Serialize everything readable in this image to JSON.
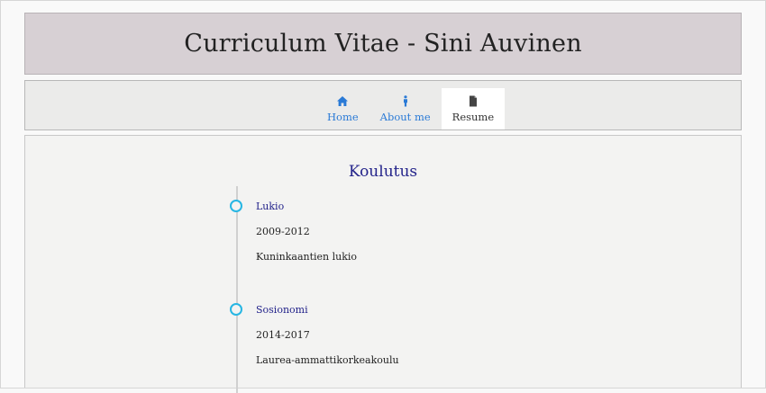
{
  "header": {
    "title": "Curriculum Vitae - Sini Auvinen"
  },
  "nav": {
    "tabs": [
      {
        "label": "Home",
        "icon": "home-icon",
        "active": false
      },
      {
        "label": "About me",
        "icon": "person-icon",
        "active": false
      },
      {
        "label": "Resume",
        "icon": "document-icon",
        "active": true
      }
    ]
  },
  "main": {
    "section_title": "Koulutus",
    "items": [
      {
        "title": "Lukio",
        "years": "2009-2012",
        "school": "Kuninkaantien lukio"
      },
      {
        "title": "Sosionomi",
        "years": "2014-2017",
        "school": "Laurea-ammattikorkeakoulu"
      }
    ]
  },
  "colors": {
    "header_bg": "#d7d0d4",
    "nav_bg": "#ebebea",
    "link": "#2a7ad6",
    "title_text": "#23238a",
    "timeline_dot": "#27b6e3"
  }
}
